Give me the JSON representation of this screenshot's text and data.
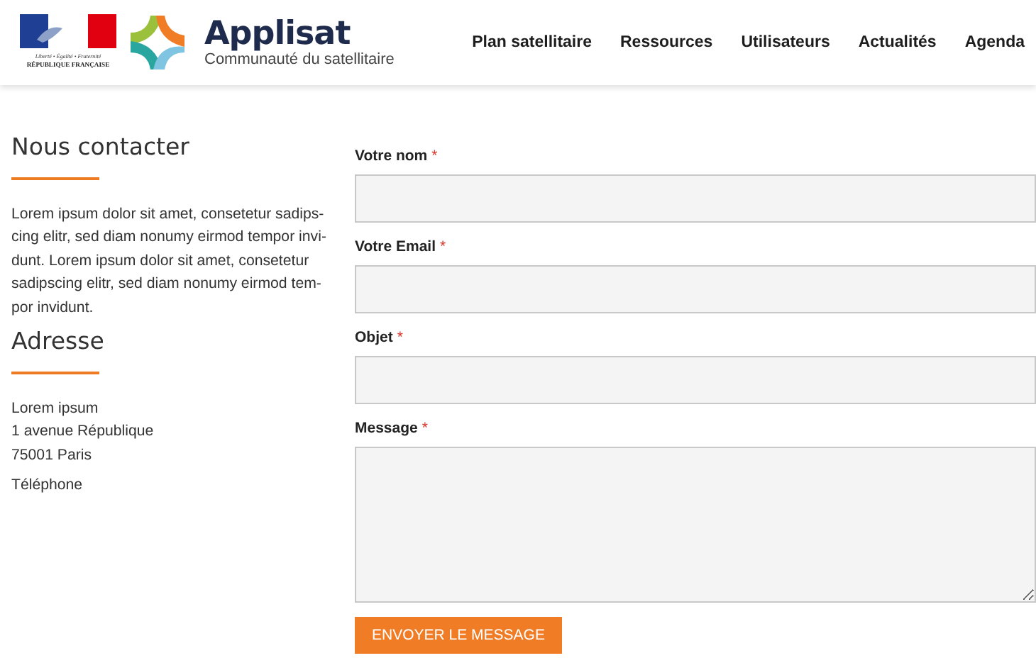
{
  "header": {
    "gov_logo": {
      "motto": "Liberté • Égalité • Fraternité",
      "name": "RÉPUBLIQUE FRANÇAISE"
    },
    "brand": {
      "title": "Applisat",
      "subtitle": "Communauté du satellitaire"
    },
    "nav": [
      {
        "label": "Plan satellitaire"
      },
      {
        "label": "Ressources"
      },
      {
        "label": "Utilisateurs"
      },
      {
        "label": "Actualités"
      },
      {
        "label": "Agenda"
      }
    ]
  },
  "contact": {
    "title": "Nous contacter",
    "paragraph_lines": [
      "Lorem ipsum dolor sit amet, consetetur sadips-",
      "cing elitr, sed diam nonumy eirmod tempor invi-",
      "dunt. Lorem ipsum dolor sit amet, consetetur",
      "sadipscing elitr, sed diam nonumy eirmod tem-",
      "por invidunt."
    ]
  },
  "address": {
    "title": "Adresse",
    "lines": [
      "Lorem ipsum",
      "1 avenue République",
      "75001 Paris"
    ],
    "phone_label": "Téléphone"
  },
  "form": {
    "fields": [
      {
        "label": "Votre nom",
        "required_mark": "*",
        "kind": "input"
      },
      {
        "label": "Votre Email",
        "required_mark": "*",
        "kind": "input"
      },
      {
        "label": "Objet",
        "required_mark": "*",
        "kind": "input"
      },
      {
        "label": "Message",
        "required_mark": "*",
        "kind": "textarea"
      }
    ],
    "submit": "ENVOYER LE MESSAGE"
  }
}
